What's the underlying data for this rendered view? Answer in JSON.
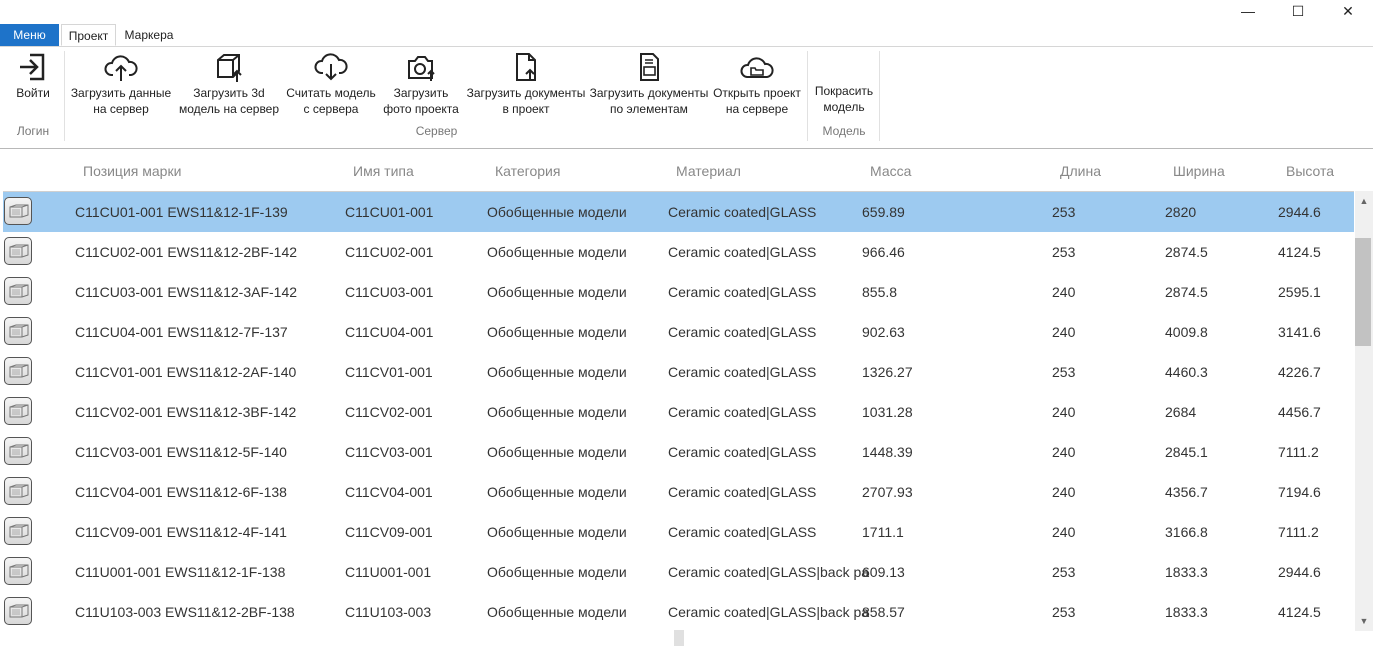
{
  "window": {
    "minimize": "—",
    "maximize": "☐",
    "close": "✕"
  },
  "tabs": [
    "Меню",
    "Проект",
    "Маркера"
  ],
  "ribbon": {
    "login": {
      "button": "Войти",
      "group": "Логин"
    },
    "server": {
      "group": "Сервер",
      "buttons": [
        {
          "line1": "Загрузить данные",
          "line2": "на сервер"
        },
        {
          "line1": "Загрузить 3d",
          "line2": "модель на сервер"
        },
        {
          "line1": "Считать модель",
          "line2": "с сервера"
        },
        {
          "line1": "Загрузить",
          "line2": "фото проекта"
        },
        {
          "line1": "Загрузить документы",
          "line2": "в проект"
        },
        {
          "line1": "Загрузить документы",
          "line2": "по элементам"
        },
        {
          "line1": "Открыть проект",
          "line2": "на сервере"
        }
      ]
    },
    "model": {
      "group": "Модель",
      "button": {
        "line1": "Покрасить",
        "line2": "модель"
      }
    }
  },
  "columns": [
    "Позиция марки",
    "Имя типа",
    "Категория",
    "Материал",
    "Масса",
    "Длина",
    "Ширина",
    "Высота"
  ],
  "rows": [
    {
      "pos": "C11CU01-001 EWS11&12-1F-139",
      "type": "C11CU01-001",
      "cat": "Обобщенные модели",
      "mat": "Ceramic coated|GLASS",
      "mass": "659.89",
      "len": "253",
      "wid": "2820",
      "hgt": "2944.6"
    },
    {
      "pos": "C11CU02-001 EWS11&12-2BF-142",
      "type": "C11CU02-001",
      "cat": "Обобщенные модели",
      "mat": "Ceramic coated|GLASS",
      "mass": "966.46",
      "len": "253",
      "wid": "2874.5",
      "hgt": "4124.5"
    },
    {
      "pos": "C11CU03-001 EWS11&12-3AF-142",
      "type": "C11CU03-001",
      "cat": "Обобщенные модели",
      "mat": "Ceramic coated|GLASS",
      "mass": "855.8",
      "len": "240",
      "wid": "2874.5",
      "hgt": "2595.1"
    },
    {
      "pos": "C11CU04-001 EWS11&12-7F-137",
      "type": "C11CU04-001",
      "cat": "Обобщенные модели",
      "mat": "Ceramic coated|GLASS",
      "mass": "902.63",
      "len": "240",
      "wid": "4009.8",
      "hgt": "3141.6"
    },
    {
      "pos": "C11CV01-001 EWS11&12-2AF-140",
      "type": "C11CV01-001",
      "cat": "Обобщенные модели",
      "mat": "Ceramic coated|GLASS",
      "mass": "1326.27",
      "len": "253",
      "wid": "4460.3",
      "hgt": "4226.7"
    },
    {
      "pos": "C11CV02-001 EWS11&12-3BF-142",
      "type": "C11CV02-001",
      "cat": "Обобщенные модели",
      "mat": "Ceramic coated|GLASS",
      "mass": "1031.28",
      "len": "240",
      "wid": "2684",
      "hgt": "4456.7"
    },
    {
      "pos": "C11CV03-001 EWS11&12-5F-140",
      "type": "C11CV03-001",
      "cat": "Обобщенные модели",
      "mat": "Ceramic coated|GLASS",
      "mass": "1448.39",
      "len": "240",
      "wid": "2845.1",
      "hgt": "7111.2"
    },
    {
      "pos": "C11CV04-001 EWS11&12-6F-138",
      "type": "C11CV04-001",
      "cat": "Обобщенные модели",
      "mat": "Ceramic coated|GLASS",
      "mass": "2707.93",
      "len": "240",
      "wid": "4356.7",
      "hgt": "7194.6"
    },
    {
      "pos": "C11CV09-001 EWS11&12-4F-141",
      "type": "C11CV09-001",
      "cat": "Обобщенные модели",
      "mat": "Ceramic coated|GLASS",
      "mass": "1711.1",
      "len": "240",
      "wid": "3166.8",
      "hgt": "7111.2"
    },
    {
      "pos": "C11U001-001 EWS11&12-1F-138",
      "type": "C11U001-001",
      "cat": "Обобщенные модели",
      "mat": "Ceramic coated|GLASS|back pa",
      "mass": "609.13",
      "len": "253",
      "wid": "1833.3",
      "hgt": "2944.6"
    },
    {
      "pos": "C11U103-003 EWS11&12-2BF-138",
      "type": "C11U103-003",
      "cat": "Обобщенные модели",
      "mat": "Ceramic coated|GLASS|back pa",
      "mass": "858.57",
      "len": "253",
      "wid": "1833.3",
      "hgt": "4124.5"
    }
  ],
  "selected_row": 0,
  "colors": {
    "accent": "#1e73c9",
    "selection": "#9dcaf0"
  }
}
